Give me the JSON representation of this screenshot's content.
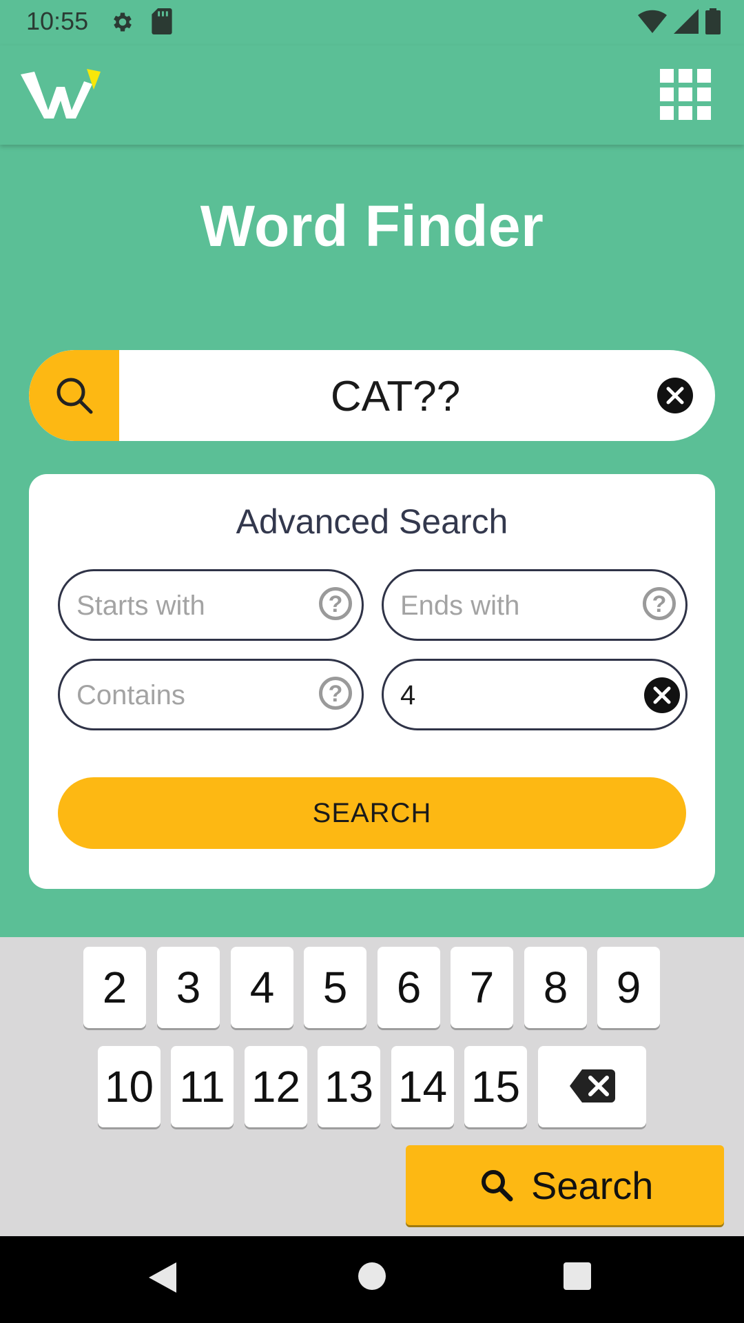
{
  "status": {
    "time": "10:55"
  },
  "app": {
    "title": "Word Finder"
  },
  "main_search": {
    "value": "CAT??"
  },
  "advanced": {
    "title": "Advanced Search",
    "starts_with_placeholder": "Starts with",
    "ends_with_placeholder": "Ends with",
    "contains_placeholder": "Contains",
    "length_value": "4",
    "search_label": "SEARCH"
  },
  "keyboard": {
    "row1": [
      "2",
      "3",
      "4",
      "5",
      "6",
      "7",
      "8",
      "9"
    ],
    "row2": [
      "10",
      "11",
      "12",
      "13",
      "14",
      "15"
    ],
    "search_label": "Search"
  },
  "colors": {
    "background": "#5bbf96",
    "accent": "#fdb813",
    "card": "#ffffff",
    "text_dark": "#33384d"
  }
}
